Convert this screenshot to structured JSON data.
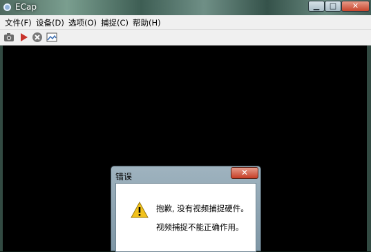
{
  "window": {
    "title": "ECap"
  },
  "menu": [
    {
      "label": "文件(F)"
    },
    {
      "label": "设备(D)"
    },
    {
      "label": "选项(O)"
    },
    {
      "label": "捕捉(C)"
    },
    {
      "label": "帮助(H)"
    }
  ],
  "toolbar": [
    {
      "icon": "camera-icon"
    },
    {
      "icon": "play-icon"
    },
    {
      "icon": "stop-icon"
    },
    {
      "icon": "image-icon"
    }
  ],
  "dialog": {
    "title": "错误",
    "close_label": "✕",
    "message_line1": "抱歉, 没有视频捕捉硬件。",
    "message_line2": "视频捕捉不能正确作用。",
    "icon": "warning-icon"
  },
  "colors": {
    "video_bg": "#000000",
    "menu_bg": "#f0f0f0",
    "close_red": "#c9452c",
    "warning_yellow": "#f2c21b"
  }
}
